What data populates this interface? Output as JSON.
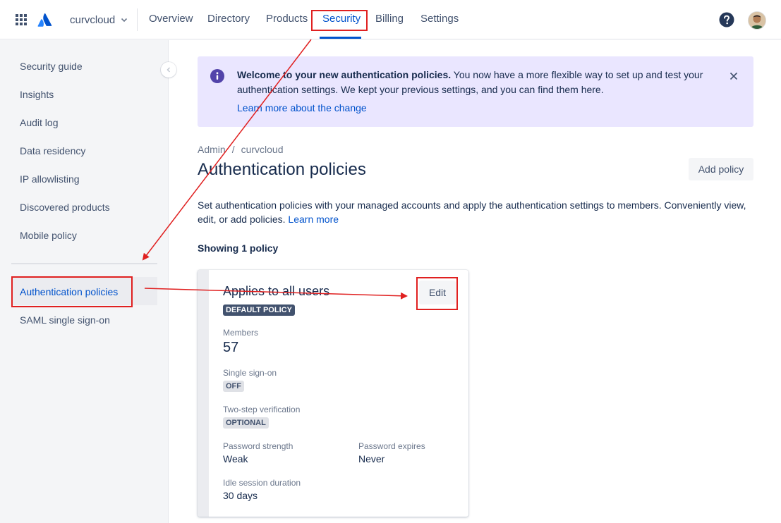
{
  "topnav": {
    "org_name": "curvcloud",
    "items": [
      "Overview",
      "Directory",
      "Products",
      "Security",
      "Billing",
      "Settings"
    ],
    "active": "Security",
    "icons": [
      "app-switcher-icon",
      "atlassian-logo-icon",
      "chevron-down-icon",
      "help-icon",
      "avatar"
    ]
  },
  "sidebar": {
    "items": [
      "Security guide",
      "Insights",
      "Audit log",
      "Data residency",
      "IP allowlisting",
      "Discovered products",
      "Mobile policy"
    ],
    "section_items": [
      "Authentication policies",
      "SAML single sign-on"
    ],
    "active": "Authentication policies"
  },
  "banner": {
    "title": "Welcome to your new authentication policies.",
    "body": " You now have a more flexible way to set up and test your authentication settings. We kept your previous settings, and you can find them here.",
    "link": "Learn more about the change"
  },
  "breadcrumb": [
    "Admin",
    "curvcloud"
  ],
  "page": {
    "title": "Authentication policies",
    "add_button": "Add policy",
    "description": "Set authentication policies with your managed accounts and apply the authentication settings to members. Conveniently view, edit, or add policies.",
    "description_link": "Learn more",
    "showing": "Showing 1 policy"
  },
  "policy_card": {
    "title": "Applies to all users",
    "badge": "DEFAULT POLICY",
    "edit_button": "Edit",
    "members_label": "Members",
    "members_value": "57",
    "sso_label": "Single sign-on",
    "sso_value": "OFF",
    "two_step_label": "Two-step verification",
    "two_step_value": "OPTIONAL",
    "password_strength_label": "Password strength",
    "password_strength_value": "Weak",
    "password_expires_label": "Password expires",
    "password_expires_value": "Never",
    "idle_label": "Idle session duration",
    "idle_value": "30 days"
  },
  "colors": {
    "primary": "#0052cc",
    "banner_bg": "#eae6ff",
    "discovery_icon": "#5243aa",
    "annotation": "#e02020",
    "sidebar_bg": "#f4f5f7"
  }
}
